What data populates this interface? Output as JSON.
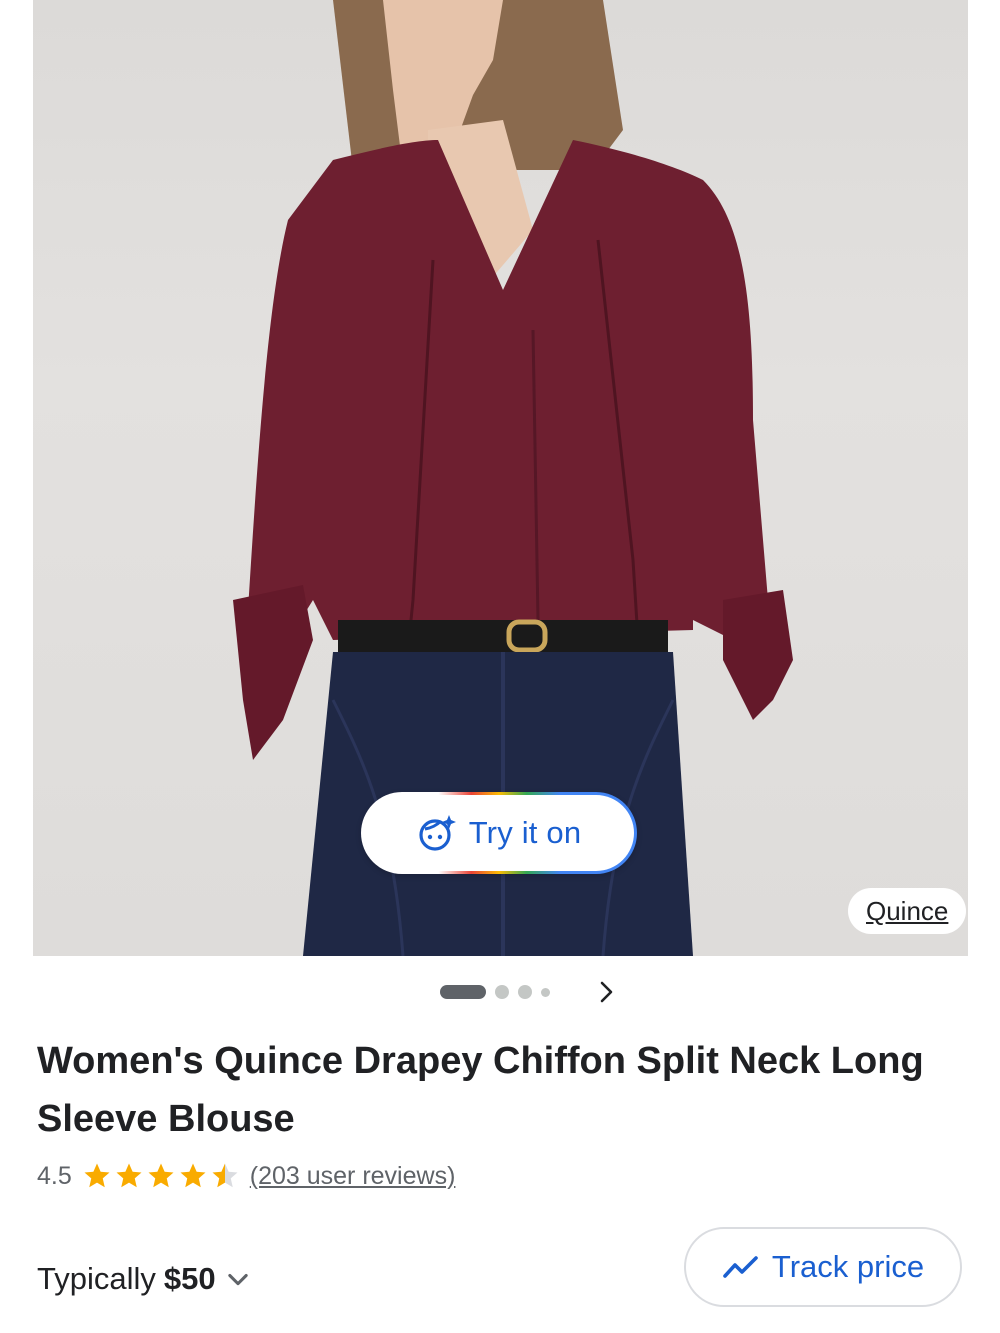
{
  "image": {
    "try_on_label": "Try it on",
    "merchant": "Quince",
    "carousel_count": 4,
    "carousel_active_index": 0
  },
  "product": {
    "title": "Women's Quince Drapey Chiffon Split Neck Long Sleeve Blouse",
    "rating": "4.5",
    "stars_value": 4.5,
    "reviews_label": "(203 user reviews)",
    "price_prefix": "Typically",
    "price": "$50",
    "track_price_label": "Track price"
  },
  "colors": {
    "accent_blue": "#1a5fd0",
    "star_yellow": "#f9ab00",
    "text_primary": "#202124",
    "text_secondary": "#5f6368",
    "blouse": "#6e1f30",
    "denim": "#1f2845"
  },
  "icons": {
    "try_on": "face-sparkle-icon",
    "next": "chevron-right-icon",
    "price_dropdown": "chevron-down-icon",
    "track": "trending-line-icon"
  }
}
